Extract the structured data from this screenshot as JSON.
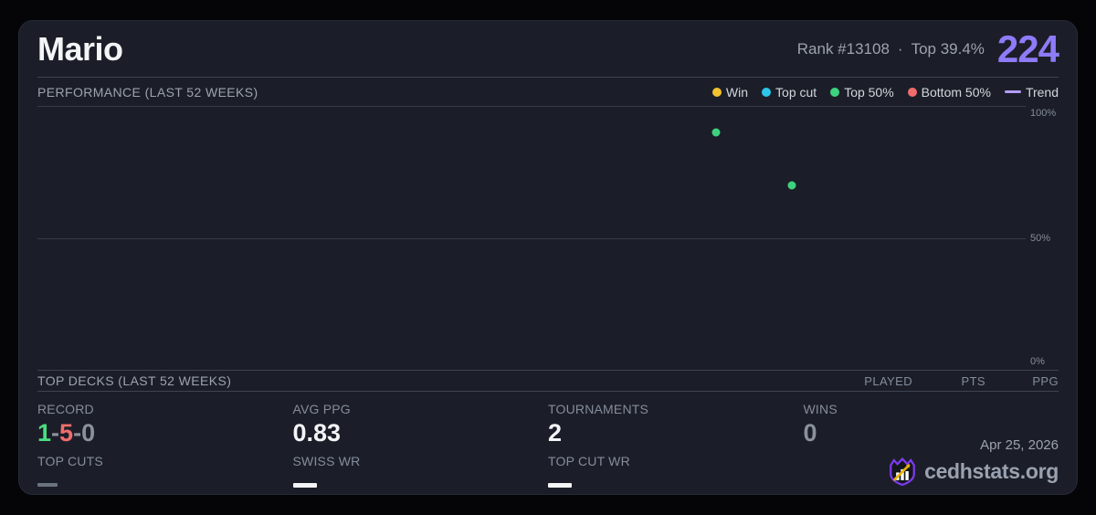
{
  "player": {
    "name": "Mario",
    "rank": "Rank #13108",
    "separator": "·",
    "top_percent": "Top 39.4%",
    "points": "224"
  },
  "performance": {
    "title": "PERFORMANCE (LAST 52 WEEKS)",
    "legend": [
      {
        "label": "Win",
        "color": "#f2c230",
        "type": "dot"
      },
      {
        "label": "Top cut",
        "color": "#2cc5e8",
        "type": "dot"
      },
      {
        "label": "Top 50%",
        "color": "#3ed17e",
        "type": "dot"
      },
      {
        "label": "Bottom 50%",
        "color": "#f06d6d",
        "type": "dot"
      },
      {
        "label": "Trend",
        "color": "#b39df8",
        "type": "line"
      }
    ]
  },
  "chart_data": {
    "type": "scatter",
    "title": "PERFORMANCE (LAST 52 WEEKS)",
    "x_axis": {
      "label": "last 52 weeks",
      "range_pct": [
        0,
        100
      ],
      "ticks_shown": false
    },
    "y_axis": {
      "ticks": [
        "100%",
        "50%",
        "0%"
      ],
      "range": [
        0,
        100
      ],
      "position": "right"
    },
    "grid": true,
    "legend_position": "top-right",
    "points": [
      {
        "series": "Top 50%",
        "x_pct": 68.7,
        "y_pct": 90,
        "color": "#3ed17e"
      },
      {
        "series": "Top 50%",
        "x_pct": 76.3,
        "y_pct": 70,
        "color": "#3ed17e"
      }
    ]
  },
  "top_decks": {
    "title": "TOP DECKS (LAST 52 WEEKS)",
    "columns": [
      "PLAYED",
      "PTS",
      "PPG"
    ]
  },
  "stats": {
    "record": {
      "label": "RECORD",
      "wins": "1",
      "losses": "5",
      "draws": "0",
      "separator": "-"
    },
    "avg_ppg": {
      "label": "AVG PPG",
      "value": "0.83"
    },
    "tournaments": {
      "label": "TOURNAMENTS",
      "value": "2"
    },
    "wins": {
      "label": "WINS",
      "value": "0"
    },
    "top_cuts": {
      "label": "TOP CUTS",
      "value": "—"
    },
    "swiss_wr": {
      "label": "SWISS WR",
      "value": "—"
    },
    "top_cut_wr": {
      "label": "TOP CUT WR",
      "value": "—"
    }
  },
  "footer": {
    "date": "Apr 25, 2026",
    "site": "cedhstats.org"
  },
  "colors": {
    "accent_purple": "#8d7bf8",
    "win_yellow": "#f2c230",
    "topcut_cyan": "#2cc5e8",
    "top50_green": "#3ed17e",
    "bottom50_red": "#f06d6d",
    "trend_purple": "#b39df8",
    "card_bg": "#1b1e28",
    "page_bg": "#050507"
  }
}
